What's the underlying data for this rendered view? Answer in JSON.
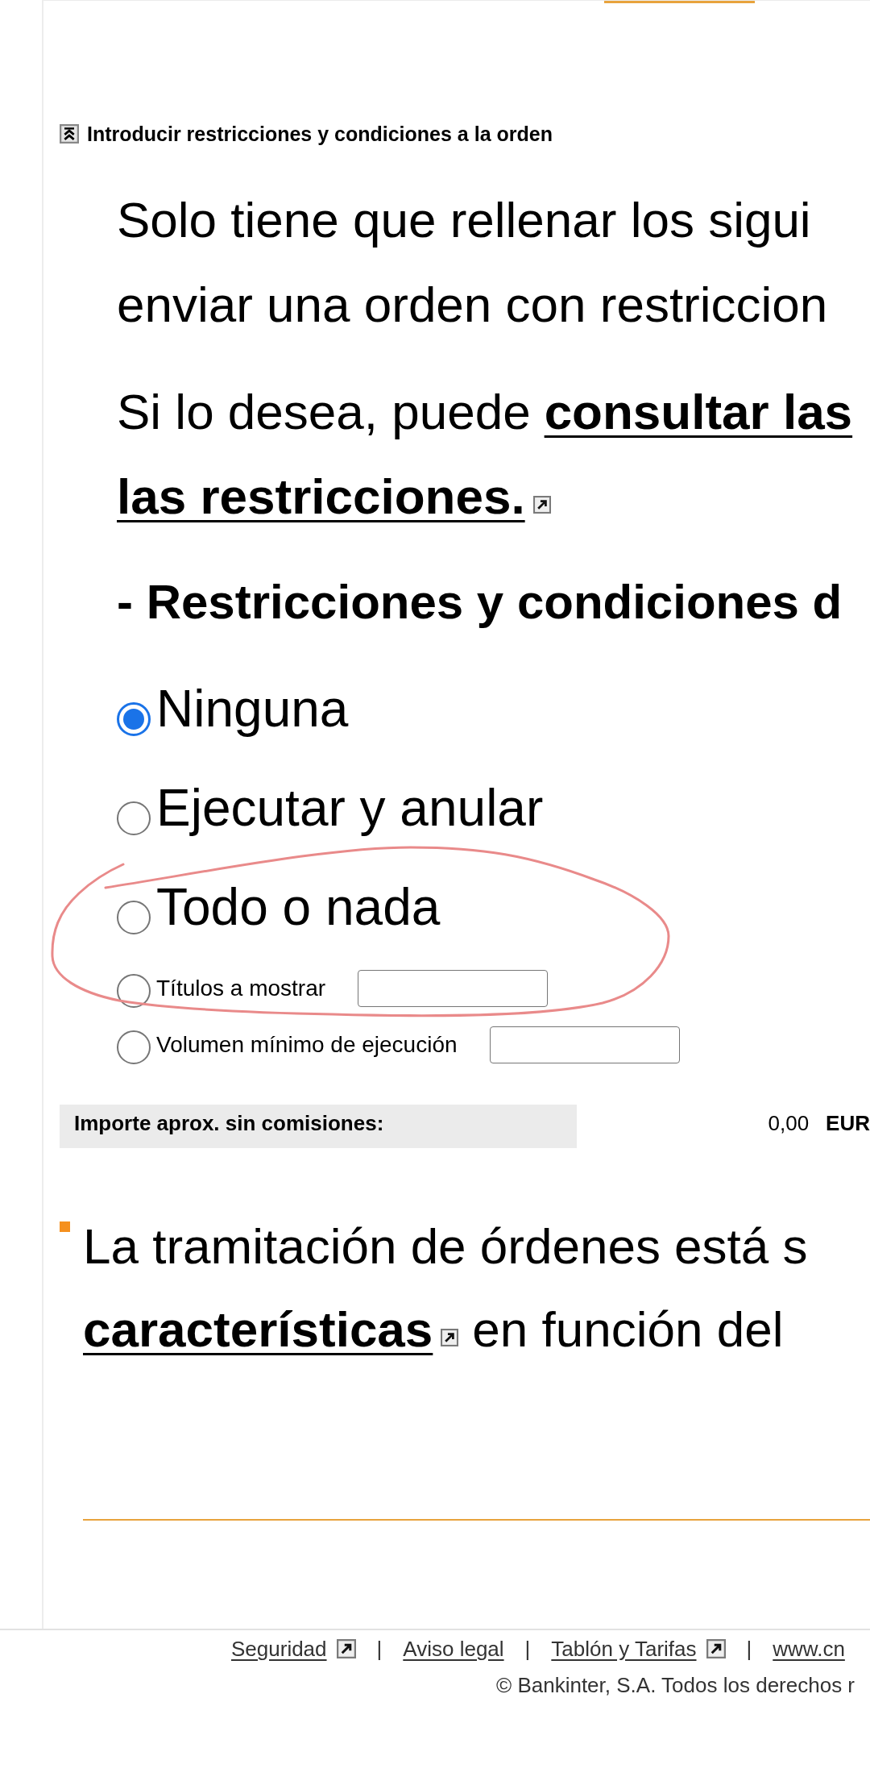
{
  "section_header": {
    "title": "Introducir restricciones y condiciones a la orden"
  },
  "intro_paragraph": {
    "lines": [
      [
        {
          "kind": "text",
          "text": "Solo tiene que rellenar los sigui"
        }
      ],
      [
        {
          "kind": "text",
          "text": "enviar una orden con restriccion"
        }
      ]
    ]
  },
  "info_paragraph": {
    "lines": [
      [
        {
          "kind": "text",
          "text": "Si lo desea, puede"
        },
        {
          "kind": "link",
          "text": "consultar las",
          "external": false
        }
      ],
      [
        {
          "kind": "link",
          "text": "las restricciones.",
          "external": true
        }
      ]
    ]
  },
  "options_heading": "- Restricciones y condiciones d",
  "restriction_options": [
    {
      "kind": "plain",
      "label": "Ninguna",
      "selected": true
    },
    {
      "kind": "plain",
      "label": "Ejecutar y anular",
      "selected": false
    },
    {
      "kind": "plain",
      "label": "Todo o nada",
      "selected": false
    },
    {
      "kind": "with_field",
      "label": "Títulos a mostrar",
      "selected": false
    },
    {
      "kind": "with_field",
      "label": "Volumen mínimo de ejecución",
      "selected": false
    }
  ],
  "estimate": {
    "label": "Importe aprox. sin comisiones:",
    "amount": "0,00",
    "currency": "EUR"
  },
  "notice": {
    "lines": [
      [
        {
          "kind": "text",
          "text": "La tramitación de órdenes está s"
        }
      ],
      [
        {
          "kind": "link",
          "text": "características",
          "external": true
        },
        {
          "kind": "text",
          "text": "en función del"
        }
      ]
    ]
  },
  "footer": {
    "items": [
      {
        "kind": "link",
        "text": "Seguridad",
        "external": true
      },
      {
        "kind": "separator",
        "text": "|"
      },
      {
        "kind": "link",
        "text": "Aviso legal",
        "external": false
      },
      {
        "kind": "separator",
        "text": "|"
      },
      {
        "kind": "link",
        "text": "Tablón y Tarifas",
        "external": true
      },
      {
        "kind": "separator",
        "text": "|"
      },
      {
        "kind": "link",
        "text": "www.cn",
        "external": false
      }
    ],
    "copyright": "© Bankinter, S.A. Todos los derechos r"
  }
}
